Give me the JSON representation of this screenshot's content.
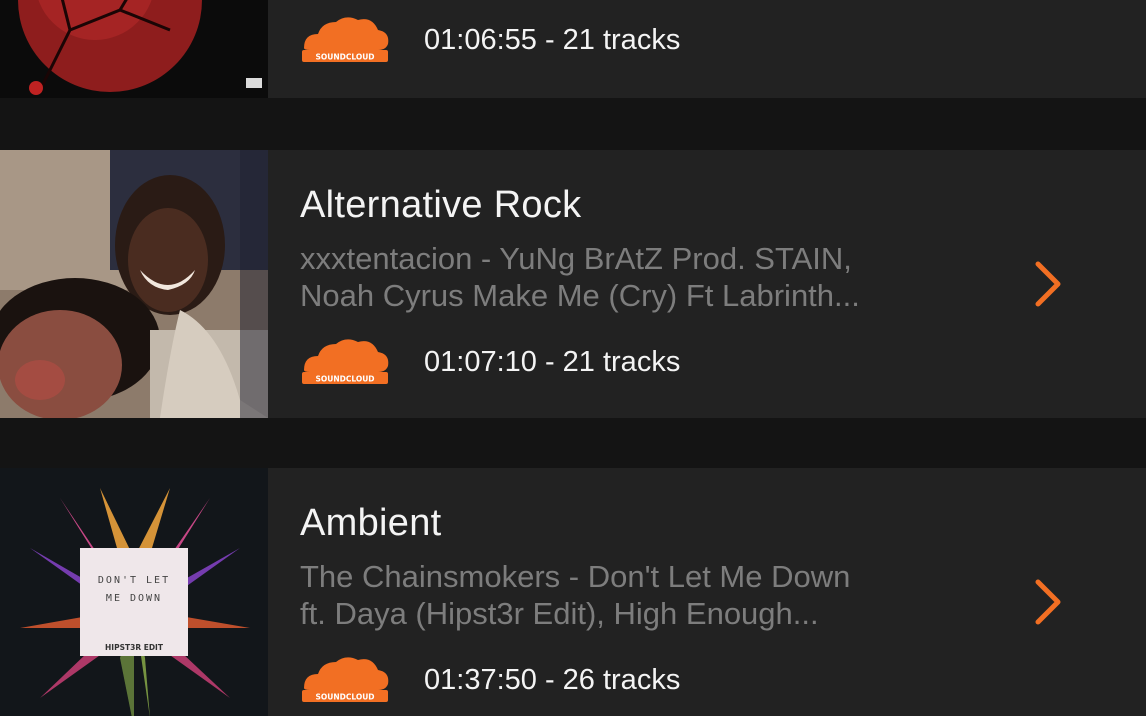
{
  "accent_color": "#f26f23",
  "playlists": [
    {
      "title": "",
      "description": "",
      "duration": "01:06:55 - 21 tracks",
      "source_icon": "soundcloud-icon",
      "source_label": "SOUNDCLOUD"
    },
    {
      "title": "Alternative Rock",
      "description": "xxxtentacion - YuNg BrAtZ Prod. STAIN,\nNoah Cyrus   Make Me (Cry) Ft Labrinth...",
      "duration": "01:07:10 - 21 tracks",
      "source_icon": "soundcloud-icon",
      "source_label": "SOUNDCLOUD"
    },
    {
      "title": "Ambient",
      "description": "The Chainsmokers - Don't Let Me Down\nft. Daya (Hipst3r Edit), High Enough...",
      "duration": "01:37:50 - 26 tracks",
      "source_icon": "soundcloud-icon",
      "source_label": "SOUNDCLOUD",
      "cover_text": [
        "DON'T LET",
        "ME DOWN",
        "HIPST3R EDIT"
      ]
    }
  ]
}
